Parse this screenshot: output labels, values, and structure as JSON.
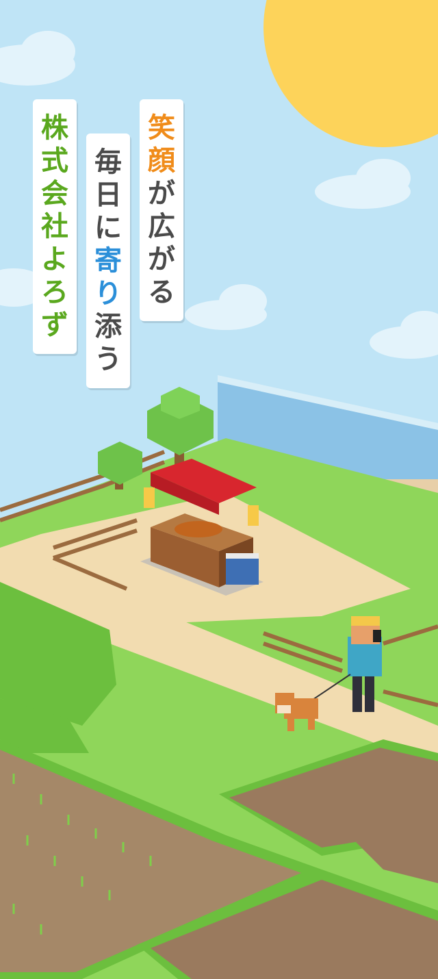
{
  "tagline_company": {
    "chars": [
      "株",
      "式",
      "会",
      "社",
      "よ",
      "ろ",
      "ず"
    ]
  },
  "tagline_daily": {
    "chars": [
      "毎",
      "日",
      "に",
      "寄",
      "り",
      "添",
      "う"
    ],
    "accent_indices": [
      3,
      4
    ]
  },
  "tagline_smile": {
    "chars": [
      "笑",
      "顔",
      "が",
      "広",
      "が",
      "る"
    ],
    "accent_indices": [
      0,
      1
    ]
  },
  "colors": {
    "sky": "#bfe4f6",
    "sun": "#fdd35a",
    "grass": "#8fd65a",
    "path": "#f2dcb0",
    "soil": "#9a7a5e",
    "company_green": "#5aa81e",
    "accent_blue": "#2b8fd9",
    "accent_orange": "#f08c1a",
    "text_dark": "#4a4a4a"
  },
  "scene": {
    "icons": [
      "sun-icon",
      "cloud-icon",
      "food-stall-icon",
      "tree-icon",
      "fence-icon",
      "person-icon",
      "dog-icon",
      "rice-field-icon",
      "billboard-icon"
    ]
  }
}
